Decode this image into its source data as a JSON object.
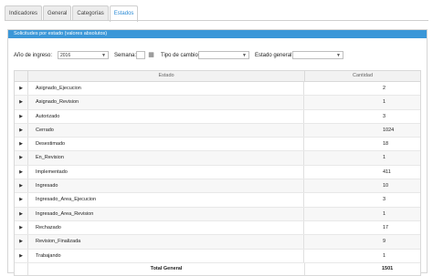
{
  "tabs": [
    "Indicadores",
    "General",
    "Categorías",
    "Estados"
  ],
  "active_tab": 3,
  "panel": {
    "title": "Solicitudes por estado (valores absolutos)"
  },
  "filters": {
    "year_label": "Año de ingreso:",
    "year_value": "2016",
    "week_label": "Semana:",
    "week_value": "",
    "change_type_label": "Tipo de cambio:",
    "change_type_value": "",
    "general_state_label": "Estado general:",
    "general_state_value": ""
  },
  "table": {
    "columns": [
      "Estado",
      "Cantidad"
    ],
    "rows": [
      {
        "estado": "Asignado_Ejecucion",
        "cantidad": "2"
      },
      {
        "estado": "Asignado_Revision",
        "cantidad": "1"
      },
      {
        "estado": "Autorizado",
        "cantidad": "3"
      },
      {
        "estado": "Cerrado",
        "cantidad": "1024"
      },
      {
        "estado": "Desestimado",
        "cantidad": "18"
      },
      {
        "estado": "En_Revision",
        "cantidad": "1"
      },
      {
        "estado": "Implementado",
        "cantidad": "411"
      },
      {
        "estado": "Ingresado",
        "cantidad": "10"
      },
      {
        "estado": "Ingresado_Area_Ejecucion",
        "cantidad": "3"
      },
      {
        "estado": "Ingresado_Area_Revision",
        "cantidad": "1"
      },
      {
        "estado": "Rechazado",
        "cantidad": "17"
      },
      {
        "estado": "Revision_Finalizada",
        "cantidad": "9"
      },
      {
        "estado": "Trabajando",
        "cantidad": "1"
      }
    ],
    "total_label": "Total General",
    "total_value": "1501"
  },
  "colors": {
    "accent": "#3b97d8",
    "active_tab_text": "#2a8ad4"
  },
  "icons": {
    "expand": "play-triangle",
    "calendar": "calendar-icon",
    "dropdown": "chevron-down-icon"
  }
}
